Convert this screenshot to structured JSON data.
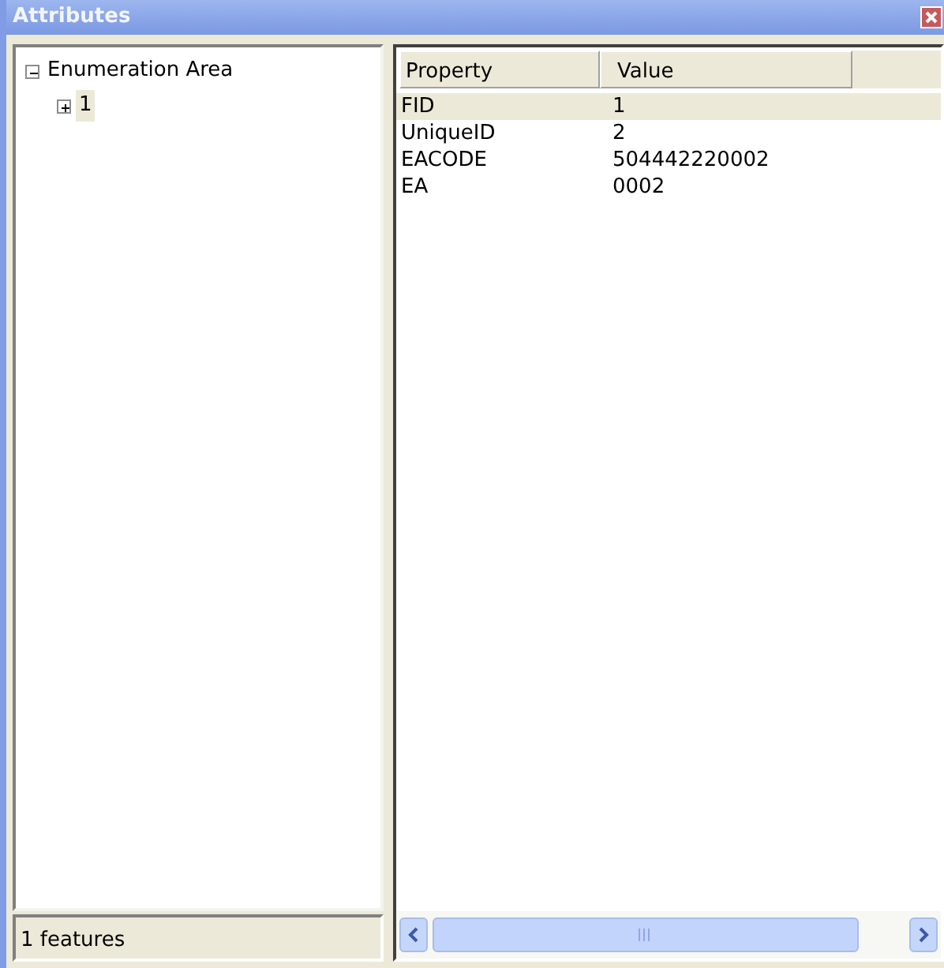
{
  "window": {
    "title": "Attributes"
  },
  "tree": [
    {
      "label": "Enumeration Area",
      "expanded": true,
      "selected": false,
      "children": [
        {
          "label": "1",
          "expanded": false,
          "selected": true
        }
      ]
    }
  ],
  "status_bar": "1 features",
  "table": {
    "columns": [
      "Property",
      "Value"
    ],
    "rows": [
      {
        "cells": [
          "FID",
          "1"
        ],
        "selected": true
      },
      {
        "cells": [
          "UniqueID",
          "2"
        ],
        "selected": false
      },
      {
        "cells": [
          "EACODE",
          "504442220002"
        ],
        "selected": false
      },
      {
        "cells": [
          "EA",
          "0002"
        ],
        "selected": false
      }
    ]
  }
}
